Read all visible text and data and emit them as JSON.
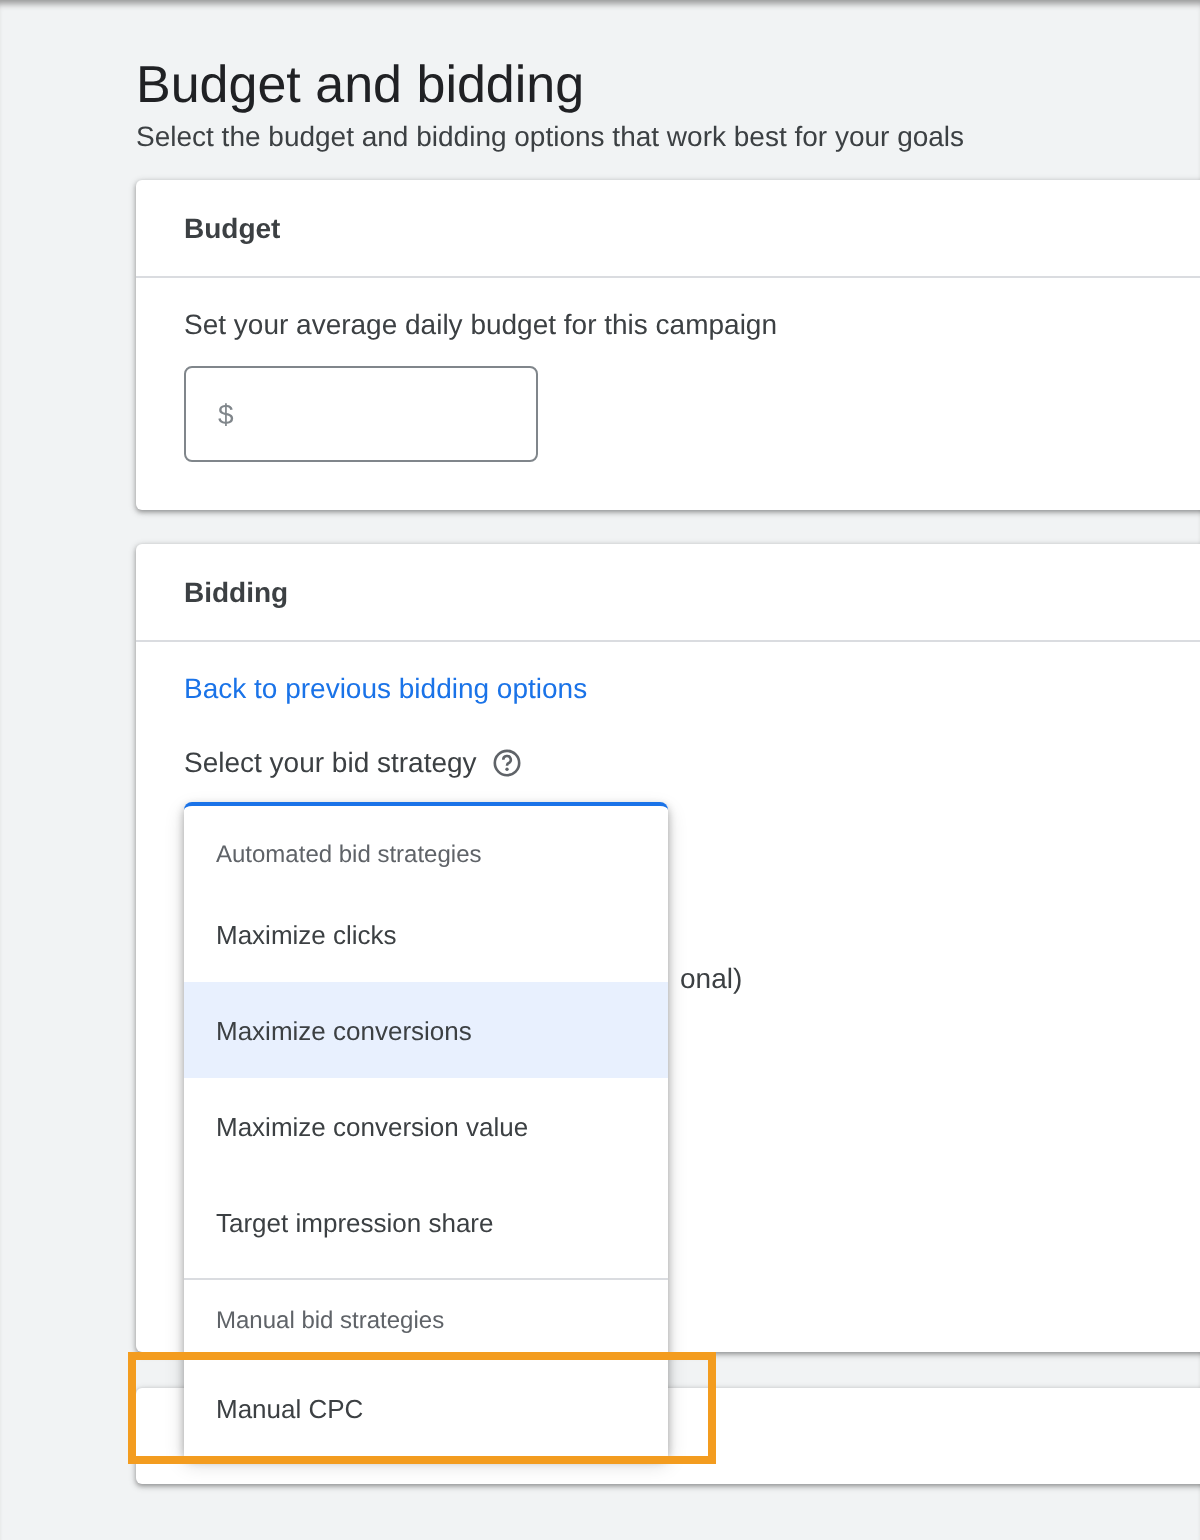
{
  "page": {
    "title": "Budget and bidding",
    "subtitle": "Select the budget and bidding options that work best for your goals"
  },
  "budget": {
    "heading": "Budget",
    "prompt": "Set your average daily budget for this campaign",
    "field": {
      "placeholder": "$"
    }
  },
  "bidding": {
    "heading": "Bidding",
    "back_link": "Back to previous bidding options",
    "strategy_label": "Select your bid strategy",
    "hidden_text": "onal)"
  },
  "strategy_menu": [
    {
      "kind": "header",
      "label": "Automated bid strategies"
    },
    {
      "kind": "option",
      "label": "Maximize clicks",
      "selected": false
    },
    {
      "kind": "option",
      "label": "Maximize conversions",
      "selected": true
    },
    {
      "kind": "option",
      "label": "Maximize conversion value",
      "selected": false
    },
    {
      "kind": "option",
      "label": "Target impression share",
      "selected": false
    },
    {
      "kind": "header",
      "label": "Manual bid strategies"
    },
    {
      "kind": "option",
      "label": "Manual CPC",
      "selected": false,
      "highlighted": true
    }
  ]
}
